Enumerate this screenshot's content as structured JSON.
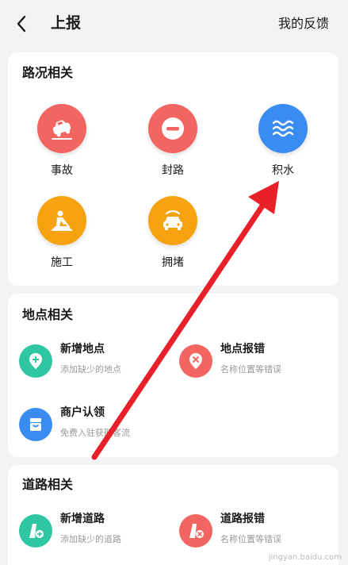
{
  "header": {
    "title": "上报",
    "feedback_label": "我的反馈"
  },
  "road_section": {
    "title": "路况相关",
    "items": [
      {
        "label": "事故",
        "icon": "accident-car-icon",
        "color": "#f26560"
      },
      {
        "label": "封路",
        "icon": "no-entry-icon",
        "color": "#f26560"
      },
      {
        "label": "积水",
        "icon": "water-waves-icon",
        "color": "#3a8bf2"
      },
      {
        "label": "施工",
        "icon": "construction-worker-icon",
        "color": "#f7a20f"
      },
      {
        "label": "拥堵",
        "icon": "traffic-jam-car-icon",
        "color": "#f7a20f"
      }
    ]
  },
  "place_section": {
    "title": "地点相关",
    "items": [
      {
        "title": "新增地点",
        "subtitle": "添加缺少的地点",
        "icon": "add-place-icon",
        "color": "#2ec7a2"
      },
      {
        "title": "地点报错",
        "subtitle": "名称位置等错误",
        "icon": "place-error-icon",
        "color": "#f26560"
      },
      {
        "title": "商户认领",
        "subtitle": "免费入驻获取客流",
        "icon": "shop-claim-icon",
        "color": "#3a8bf2"
      }
    ]
  },
  "route_section": {
    "title": "道路相关",
    "items": [
      {
        "title": "新增道路",
        "subtitle": "添加缺少的道路",
        "icon": "add-road-icon",
        "color": "#2ec7a2"
      },
      {
        "title": "道路报错",
        "subtitle": "名称位置等错误",
        "icon": "road-error-icon",
        "color": "#f26560"
      }
    ]
  },
  "colors": {
    "annotation_arrow": "#e8202a",
    "background": "#f2f3f5"
  },
  "watermark": "jingyan.baidu.com"
}
